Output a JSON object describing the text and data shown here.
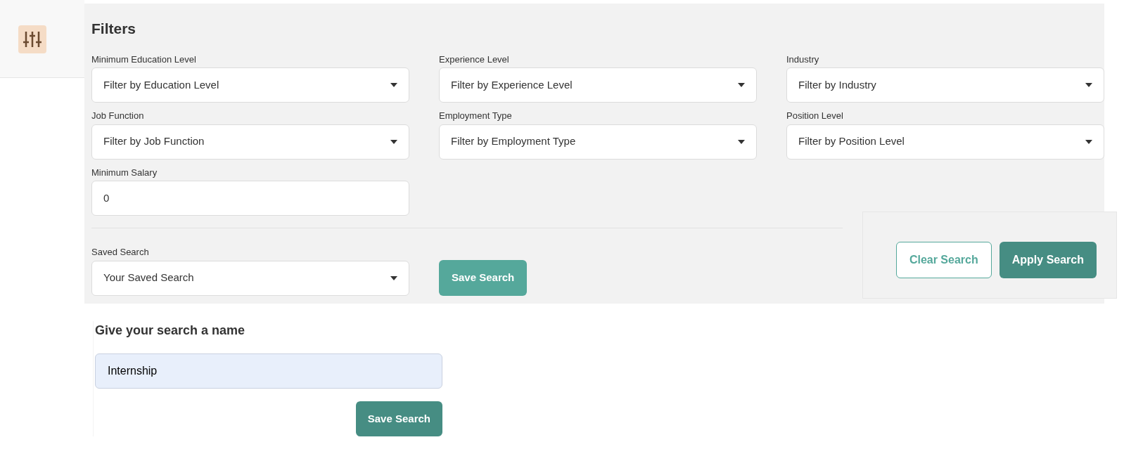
{
  "filters": {
    "title": "Filters",
    "fields": [
      {
        "kind": "select",
        "label": "Minimum Education Level",
        "value": "Filter by Education Level"
      },
      {
        "kind": "select",
        "label": "Experience Level",
        "value": "Filter by Experience Level"
      },
      {
        "kind": "select",
        "label": "Industry",
        "value": "Filter by Industry"
      },
      {
        "kind": "select",
        "label": "Job Function",
        "value": "Filter by Job Function"
      },
      {
        "kind": "select",
        "label": "Employment Type",
        "value": "Filter by Employment Type"
      },
      {
        "kind": "select",
        "label": "Position Level",
        "value": "Filter by Position Level"
      },
      {
        "kind": "input",
        "label": "Minimum Salary",
        "value": "0"
      }
    ],
    "saved_search": {
      "label": "Saved Search",
      "value": "Your Saved Search"
    },
    "save_button": "Save Search",
    "clear_button": "Clear Search",
    "apply_button": "Apply Search"
  },
  "name_form": {
    "title": "Give your search a name",
    "value": "Internship",
    "save_button": "Save Search"
  }
}
